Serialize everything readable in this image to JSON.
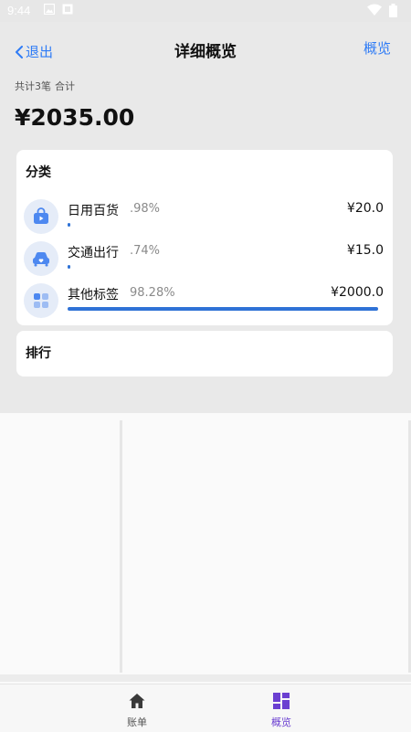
{
  "status_bar": {
    "time": "9:44"
  },
  "nav": {
    "back_label": "退出",
    "title": "详细概览",
    "overview_label": "概览"
  },
  "summary": {
    "count_text": "共计3笔",
    "total_label": "合计",
    "total_amount": "¥2035.00"
  },
  "category_card": {
    "title": "分类",
    "items": [
      {
        "name": "日用百货",
        "percent_text": ".98%",
        "percent": 0.98,
        "amount": "¥20.0",
        "icon": "shopping-bag-icon"
      },
      {
        "name": "交通出行",
        "percent_text": ".74%",
        "percent": 0.74,
        "amount": "¥15.0",
        "icon": "car-icon"
      },
      {
        "name": "其他标签",
        "percent_text": "98.28%",
        "percent": 98.28,
        "amount": "¥2000.0",
        "icon": "grid-icon"
      }
    ]
  },
  "ranking_card": {
    "title": "排行"
  },
  "tabs": [
    {
      "label": "账单",
      "icon": "home-icon",
      "active": false
    },
    {
      "label": "概览",
      "icon": "dashboard-icon",
      "active": true
    }
  ],
  "colors": {
    "accent": "#2f7cf6",
    "bar": "#2f72d6",
    "tab_active": "#6b3fd1",
    "tab_inactive": "#555555"
  }
}
